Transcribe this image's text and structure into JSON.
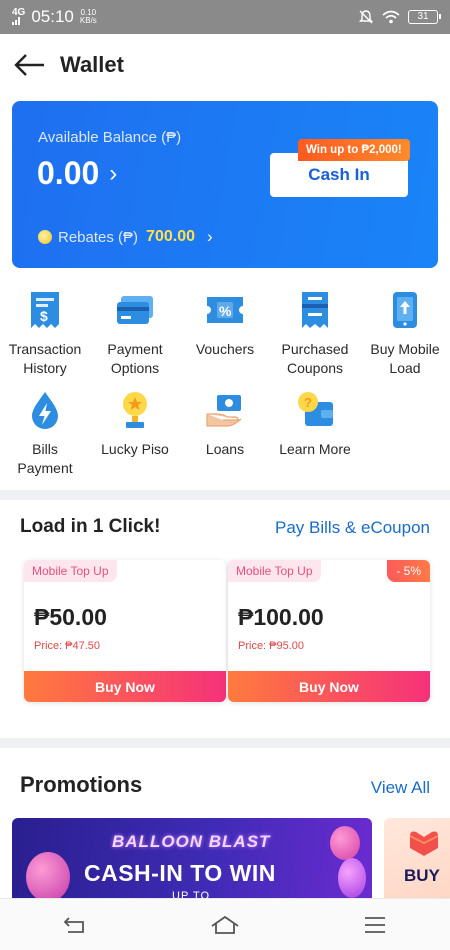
{
  "status_bar": {
    "network": "4G",
    "time": "05:10",
    "speed_value": "0.10",
    "speed_unit": "KB/s",
    "battery": "31"
  },
  "header": {
    "title": "Wallet"
  },
  "balance": {
    "label": "Available Balance (₱)",
    "amount": "0.00",
    "promo_tag": "Win up to ₱2,000!",
    "cash_in_label": "Cash In",
    "rebates_label": "Rebates (₱)",
    "rebates_value": "700.00"
  },
  "services": [
    {
      "line1": "Transaction",
      "line2": "History",
      "icon": "receipt-dollar-icon"
    },
    {
      "line1": "Payment",
      "line2": "Options",
      "icon": "cards-icon"
    },
    {
      "line1": "Vouchers",
      "line2": "",
      "icon": "percent-ticket-icon"
    },
    {
      "line1": "Purchased",
      "line2": "Coupons",
      "icon": "coupon-icon"
    },
    {
      "line1": "Buy Mobile",
      "line2": "Load",
      "icon": "mobile-upload-icon"
    },
    {
      "line1": "Bills",
      "line2": "Payment",
      "icon": "water-drop-bolt-icon"
    },
    {
      "line1": "Lucky Piso",
      "line2": "",
      "icon": "trophy-icon"
    },
    {
      "line1": "Loans",
      "line2": "",
      "icon": "hand-money-icon"
    },
    {
      "line1": "Learn More",
      "line2": "",
      "icon": "question-wallet-icon"
    }
  ],
  "load_section": {
    "title": "Load in 1 Click!",
    "link": "Pay Bills & eCoupon",
    "cards": [
      {
        "tag": "Mobile Top Up",
        "amount": "₱50.00",
        "price": "Price: ₱47.50",
        "button": "Buy Now",
        "discount": ""
      },
      {
        "tag": "Mobile Top Up",
        "amount": "₱100.00",
        "price": "Price: ₱95.00",
        "button": "Buy Now",
        "discount": "- 5%"
      }
    ]
  },
  "promotions": {
    "title": "Promotions",
    "view_all": "View All",
    "banner_line1": "BALLOON BLAST",
    "banner_line2": "CASH-IN TO WIN",
    "banner_line3": "UP TO",
    "banner2_text": "BUY"
  },
  "colors": {
    "accent_blue": "#1f6ff0",
    "link_blue": "#1a6cc9",
    "buy_gradient_start": "#ff7a3d",
    "buy_gradient_end": "#f5317a",
    "rebate_yellow": "#ffe14d"
  }
}
